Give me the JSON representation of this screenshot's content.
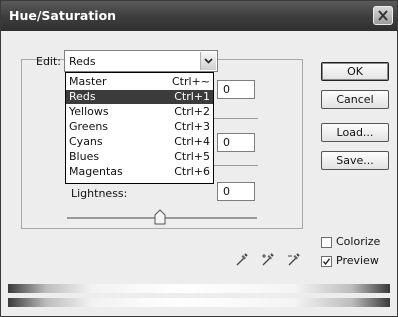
{
  "window": {
    "title": "Hue/Saturation"
  },
  "edit": {
    "label": "Edit:",
    "selected": "Reds",
    "options": [
      {
        "label": "Master",
        "shortcut": "Ctrl+~"
      },
      {
        "label": "Reds",
        "shortcut": "Ctrl+1",
        "selected": true
      },
      {
        "label": "Yellows",
        "shortcut": "Ctrl+2"
      },
      {
        "label": "Greens",
        "shortcut": "Ctrl+3"
      },
      {
        "label": "Cyans",
        "shortcut": "Ctrl+4"
      },
      {
        "label": "Blues",
        "shortcut": "Ctrl+5"
      },
      {
        "label": "Magentas",
        "shortcut": "Ctrl+6"
      }
    ]
  },
  "fields": {
    "hue": "0",
    "saturation": "0",
    "lightness_label": "Lightness:",
    "lightness": "0"
  },
  "lightness_slider_level": 0.5,
  "buttons": {
    "ok": "OK",
    "cancel": "Cancel",
    "load": "Load...",
    "save": "Save..."
  },
  "options": {
    "colorize_label": "Colorize",
    "colorize_checked": false,
    "preview_label": "Preview",
    "preview_checked": true
  },
  "icons": [
    "close-icon",
    "chevron-down-icon",
    "eyedropper-icon",
    "eyedropper-plus-icon",
    "eyedropper-minus-icon",
    "slider-thumb-icon",
    "checkmark-icon"
  ]
}
